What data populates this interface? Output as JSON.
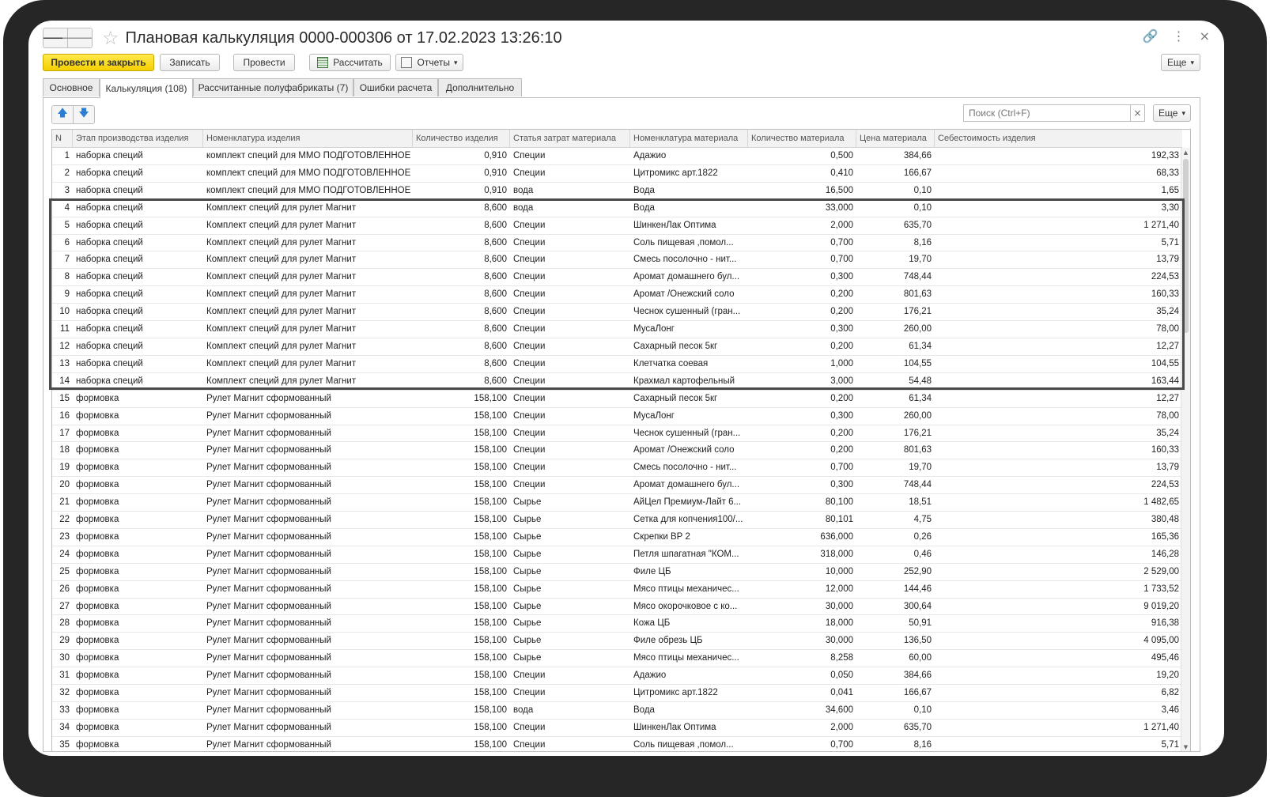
{
  "window": {
    "title": "Плановая калькуляция 0000-000306 от 17.02.2023 13:26:10",
    "back_glyph": "🡐",
    "forward_glyph": "🡒",
    "star_glyph": "☆",
    "link_glyph": "🔗",
    "menu_glyph": "⋮",
    "close_glyph": "×"
  },
  "toolbar": {
    "post_close": "Провести и закрыть",
    "save": "Записать",
    "post": "Провести",
    "calculate": "Рассчитать",
    "reports": "Отчеты",
    "reports_arrow": "▾",
    "more": "Еще",
    "more_arrow": "▾"
  },
  "tabs": [
    {
      "label": "Основное"
    },
    {
      "label": "Калькуляция (108)"
    },
    {
      "label": "Рассчитанные полуфабрикаты (7)"
    },
    {
      "label": "Ошибки расчета"
    },
    {
      "label": "Дополнительно"
    }
  ],
  "table_toolbar": {
    "up_glyph": "🡅",
    "down_glyph": "🡇",
    "search_placeholder": "Поиск (Ctrl+F)",
    "clear_glyph": "×",
    "more": "Еще",
    "more_arrow": "▾"
  },
  "columns": [
    "N",
    "Этап производства изделия",
    "Номенклатура изделия",
    "Количество изделия",
    "Статья затрат материала",
    "Номенклатура материала",
    "Количество материала",
    "Цена материала",
    "Себестоимость изделия"
  ],
  "rows": [
    [
      "1",
      "наборка специй",
      "комплект специй для ММО ПОДГОТОВЛЕННОЕ",
      "0,910",
      "Специи",
      "Адажио",
      "0,500",
      "384,66",
      "192,33"
    ],
    [
      "2",
      "наборка специй",
      "комплект специй для ММО ПОДГОТОВЛЕННОЕ",
      "0,910",
      "Специи",
      "Цитромикс арт.1822",
      "0,410",
      "166,67",
      "68,33"
    ],
    [
      "3",
      "наборка специй",
      "комплект специй для ММО ПОДГОТОВЛЕННОЕ",
      "0,910",
      "вода",
      "Вода",
      "16,500",
      "0,10",
      "1,65"
    ],
    [
      "4",
      "наборка специй",
      "Комплект специй для рулет Магнит",
      "8,600",
      "вода",
      "Вода",
      "33,000",
      "0,10",
      "3,30"
    ],
    [
      "5",
      "наборка специй",
      "Комплект специй для рулет Магнит",
      "8,600",
      "Специи",
      "ШинкенЛак Оптима",
      "2,000",
      "635,70",
      "1 271,40"
    ],
    [
      "6",
      "наборка специй",
      "Комплект специй для рулет Магнит",
      "8,600",
      "Специи",
      "Соль пищевая ,помол...",
      "0,700",
      "8,16",
      "5,71"
    ],
    [
      "7",
      "наборка специй",
      "Комплект специй для рулет Магнит",
      "8,600",
      "Специи",
      "Смесь посолочно - нит...",
      "0,700",
      "19,70",
      "13,79"
    ],
    [
      "8",
      "наборка специй",
      "Комплект специй для рулет Магнит",
      "8,600",
      "Специи",
      "Аромат домашнего бул...",
      "0,300",
      "748,44",
      "224,53"
    ],
    [
      "9",
      "наборка специй",
      "Комплект специй для рулет Магнит",
      "8,600",
      "Специи",
      "Аромат /Онежский соло",
      "0,200",
      "801,63",
      "160,33"
    ],
    [
      "10",
      "наборка специй",
      "Комплект специй для рулет Магнит",
      "8,600",
      "Специи",
      "Чеснок сушенный (гран...",
      "0,200",
      "176,21",
      "35,24"
    ],
    [
      "11",
      "наборка специй",
      "Комплект специй для рулет Магнит",
      "8,600",
      "Специи",
      "МусаЛонг",
      "0,300",
      "260,00",
      "78,00"
    ],
    [
      "12",
      "наборка специй",
      "Комплект специй для рулет Магнит",
      "8,600",
      "Специи",
      "Сахарный песок 5кг",
      "0,200",
      "61,34",
      "12,27"
    ],
    [
      "13",
      "наборка специй",
      "Комплект специй для рулет Магнит",
      "8,600",
      "Специи",
      "Клетчатка соевая",
      "1,000",
      "104,55",
      "104,55"
    ],
    [
      "14",
      "наборка специй",
      "Комплект специй для рулет Магнит",
      "8,600",
      "Специи",
      "Крахмал картофельный",
      "3,000",
      "54,48",
      "163,44"
    ],
    [
      "15",
      "формовка",
      "Рулет Магнит сформованный",
      "158,100",
      "Специи",
      "Сахарный песок 5кг",
      "0,200",
      "61,34",
      "12,27"
    ],
    [
      "16",
      "формовка",
      "Рулет Магнит сформованный",
      "158,100",
      "Специи",
      "МусаЛонг",
      "0,300",
      "260,00",
      "78,00"
    ],
    [
      "17",
      "формовка",
      "Рулет Магнит сформованный",
      "158,100",
      "Специи",
      "Чеснок сушенный (гран...",
      "0,200",
      "176,21",
      "35,24"
    ],
    [
      "18",
      "формовка",
      "Рулет Магнит сформованный",
      "158,100",
      "Специи",
      "Аромат /Онежский соло",
      "0,200",
      "801,63",
      "160,33"
    ],
    [
      "19",
      "формовка",
      "Рулет Магнит сформованный",
      "158,100",
      "Специи",
      "Смесь посолочно - нит...",
      "0,700",
      "19,70",
      "13,79"
    ],
    [
      "20",
      "формовка",
      "Рулет Магнит сформованный",
      "158,100",
      "Специи",
      "Аромат домашнего бул...",
      "0,300",
      "748,44",
      "224,53"
    ],
    [
      "21",
      "формовка",
      "Рулет Магнит сформованный",
      "158,100",
      "Сырье",
      "АйЦел Премиум-Лайт 6...",
      "80,100",
      "18,51",
      "1 482,65"
    ],
    [
      "22",
      "формовка",
      "Рулет Магнит сформованный",
      "158,100",
      "Сырье",
      "Сетка для копчения100/...",
      "80,101",
      "4,75",
      "380,48"
    ],
    [
      "23",
      "формовка",
      "Рулет Магнит сформованный",
      "158,100",
      "Сырье",
      "Скрепки ВР 2",
      "636,000",
      "0,26",
      "165,36"
    ],
    [
      "24",
      "формовка",
      "Рулет Магнит сформованный",
      "158,100",
      "Сырье",
      "Петля шпагатная \"КОМ...",
      "318,000",
      "0,46",
      "146,28"
    ],
    [
      "25",
      "формовка",
      "Рулет Магнит сформованный",
      "158,100",
      "Сырье",
      "Филе ЦБ",
      "10,000",
      "252,90",
      "2 529,00"
    ],
    [
      "26",
      "формовка",
      "Рулет Магнит сформованный",
      "158,100",
      "Сырье",
      "Мясо птицы механичес...",
      "12,000",
      "144,46",
      "1 733,52"
    ],
    [
      "27",
      "формовка",
      "Рулет Магнит сформованный",
      "158,100",
      "Сырье",
      "Мясо окорочковое с ко...",
      "30,000",
      "300,64",
      "9 019,20"
    ],
    [
      "28",
      "формовка",
      "Рулет Магнит сформованный",
      "158,100",
      "Сырье",
      "Кожа ЦБ",
      "18,000",
      "50,91",
      "916,38"
    ],
    [
      "29",
      "формовка",
      "Рулет Магнит сформованный",
      "158,100",
      "Сырье",
      "Филе обрезь ЦБ",
      "30,000",
      "136,50",
      "4 095,00"
    ],
    [
      "30",
      "формовка",
      "Рулет Магнит сформованный",
      "158,100",
      "Сырье",
      "Мясо птицы механичес...",
      "8,258",
      "60,00",
      "495,46"
    ],
    [
      "31",
      "формовка",
      "Рулет Магнит сформованный",
      "158,100",
      "Специи",
      "Адажио",
      "0,050",
      "384,66",
      "19,20"
    ],
    [
      "32",
      "формовка",
      "Рулет Магнит сформованный",
      "158,100",
      "Специи",
      "Цитромикс арт.1822",
      "0,041",
      "166,67",
      "6,82"
    ],
    [
      "33",
      "формовка",
      "Рулет Магнит сформованный",
      "158,100",
      "вода",
      "Вода",
      "34,600",
      "0,10",
      "3,46"
    ],
    [
      "34",
      "формовка",
      "Рулет Магнит сформованный",
      "158,100",
      "Специи",
      "ШинкенЛак Оптима",
      "2,000",
      "635,70",
      "1 271,40"
    ],
    [
      "35",
      "формовка",
      "Рулет Магнит сформованный",
      "158,100",
      "Специи",
      "Соль пищевая ,помол...",
      "0,700",
      "8,16",
      "5,71"
    ]
  ],
  "colors": {
    "primary_button": "#f5cf00",
    "highlight_frame": "#4a4a4a",
    "bezel": "#262626",
    "arrow_blue": "#2a7fd4"
  }
}
